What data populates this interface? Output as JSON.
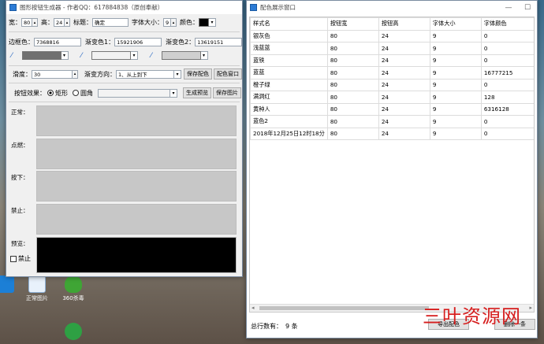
{
  "colors": {
    "accent": "#2b7bd6",
    "preview_fill": "#c7c7c7",
    "preview_black": "#000000",
    "watermark": "#d61d1d"
  },
  "desktop": {
    "icons": [
      {
        "label": "正常图片",
        "icon": "image-icon"
      },
      {
        "label": "360杀毒",
        "icon": "shield-icon"
      }
    ]
  },
  "left_window": {
    "title": "图形按钮生成器 - 作者QQ：617884838（原创奉献）",
    "width_label": "宽：",
    "width_value": "80",
    "height_label": "高：",
    "height_value": "24",
    "caption_label": "标题：",
    "caption_value": "确定",
    "font_size_label": "字体大小：",
    "font_size_value": "9",
    "color_label": "颜色：",
    "border_color_label": "边框色：",
    "border_color_value": "7368816",
    "gradient1_label": "渐变色1：",
    "gradient1_value": "15921906",
    "gradient2_label": "渐变色2：",
    "gradient2_value": "13619151",
    "smooth_label": "滑度：",
    "smooth_value": "30",
    "direction_label": "渐变方向：",
    "direction_value": "1、从上到下",
    "save_color_button": "保存配色",
    "color_window_button": "配色窗口",
    "effect_label": "按钮效果：",
    "radio_rect": "矩形",
    "radio_round": "圆角",
    "generate_preview_button": "生成预览",
    "save_image_button": "保存图片",
    "states": {
      "normal": "正常：",
      "hover": "点燃：",
      "pressed": "按下：",
      "disabled": "禁止：",
      "preview": "预览：",
      "disable_checkbox": "禁止"
    }
  },
  "right_window": {
    "title": "配色展示窗口",
    "columns": [
      "样式名",
      "按钮宽",
      "按钮高",
      "字体大小",
      "字体颜色"
    ],
    "rows": [
      [
        "银灰色",
        "80",
        "24",
        "9",
        "0"
      ],
      [
        "浅蓝蓝",
        "80",
        "24",
        "9",
        "0"
      ],
      [
        "蓝铁",
        "80",
        "24",
        "9",
        "0"
      ],
      [
        "蓝蓝",
        "80",
        "24",
        "9",
        "16777215"
      ],
      [
        "橙子绿",
        "80",
        "24",
        "9",
        "0"
      ],
      [
        "满洞红",
        "80",
        "24",
        "9",
        "128"
      ],
      [
        "黄种人",
        "80",
        "24",
        "9",
        "6316128"
      ],
      [
        "蓝色2",
        "80",
        "24",
        "9",
        "0"
      ],
      [
        "2018年12月25日12时18分",
        "80",
        "24",
        "9",
        "0"
      ]
    ],
    "total_label": "总行数有：",
    "total_value": "9 条",
    "import_button": "导出配色",
    "delete_button": "删除一条"
  },
  "watermark": "三叶资源网"
}
